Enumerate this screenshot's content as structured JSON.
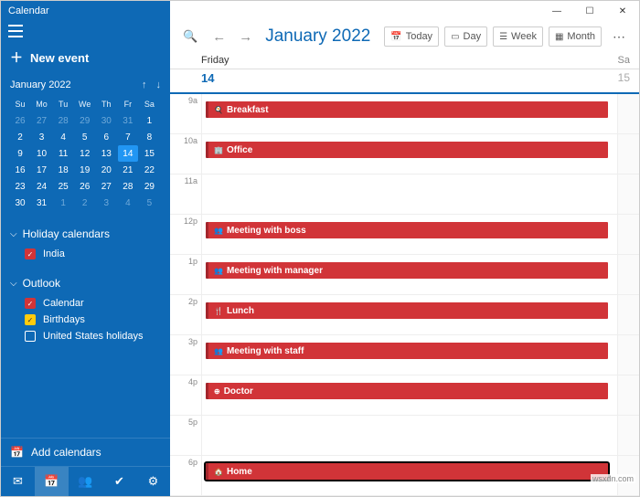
{
  "app_title": "Calendar",
  "sidebar": {
    "new_event": "New event",
    "mini_month": "January 2022",
    "weekdays": [
      "Su",
      "Mo",
      "Tu",
      "We",
      "Th",
      "Fr",
      "Sa"
    ],
    "weeks": [
      [
        {
          "d": "26",
          "dim": true
        },
        {
          "d": "27",
          "dim": true
        },
        {
          "d": "28",
          "dim": true
        },
        {
          "d": "29",
          "dim": true
        },
        {
          "d": "30",
          "dim": true
        },
        {
          "d": "31",
          "dim": true
        },
        {
          "d": "1",
          "dim": false
        }
      ],
      [
        {
          "d": "2"
        },
        {
          "d": "3"
        },
        {
          "d": "4"
        },
        {
          "d": "5"
        },
        {
          "d": "6"
        },
        {
          "d": "7"
        },
        {
          "d": "8"
        }
      ],
      [
        {
          "d": "9"
        },
        {
          "d": "10"
        },
        {
          "d": "11"
        },
        {
          "d": "12"
        },
        {
          "d": "13"
        },
        {
          "d": "14",
          "today": true
        },
        {
          "d": "15"
        }
      ],
      [
        {
          "d": "16"
        },
        {
          "d": "17"
        },
        {
          "d": "18"
        },
        {
          "d": "19"
        },
        {
          "d": "20"
        },
        {
          "d": "21"
        },
        {
          "d": "22"
        }
      ],
      [
        {
          "d": "23"
        },
        {
          "d": "24"
        },
        {
          "d": "25"
        },
        {
          "d": "26"
        },
        {
          "d": "27"
        },
        {
          "d": "28"
        },
        {
          "d": "29"
        }
      ],
      [
        {
          "d": "30"
        },
        {
          "d": "31"
        },
        {
          "d": "1",
          "dim": true
        },
        {
          "d": "2",
          "dim": true
        },
        {
          "d": "3",
          "dim": true
        },
        {
          "d": "4",
          "dim": true
        },
        {
          "d": "5",
          "dim": true
        }
      ]
    ],
    "sections": {
      "holiday": {
        "label": "Holiday calendars",
        "items": [
          {
            "label": "India",
            "color": "red",
            "checked": true
          }
        ]
      },
      "outlook": {
        "label": "Outlook",
        "items": [
          {
            "label": "Calendar",
            "color": "red",
            "checked": true
          },
          {
            "label": "Birthdays",
            "color": "yellow",
            "checked": true
          },
          {
            "label": "United States holidays",
            "color": "",
            "checked": false
          }
        ]
      }
    },
    "add_calendars": "Add calendars"
  },
  "toolbar": {
    "month_title": "January 2022",
    "today": "Today",
    "day": "Day",
    "week": "Week",
    "month": "Month"
  },
  "day_header": {
    "fri": "Friday",
    "sa": "Sa"
  },
  "dates": {
    "d14": "14",
    "d15": "15"
  },
  "hours": [
    "9a",
    "10a",
    "11a",
    "12p",
    "1p",
    "2p",
    "3p",
    "4p",
    "5p",
    "6p"
  ],
  "events": {
    "0": {
      "label": "Breakfast",
      "icon": "🍳"
    },
    "1": {
      "label": "Office",
      "icon": "🏢"
    },
    "3": {
      "label": "Meeting with boss",
      "icon": "👥"
    },
    "4": {
      "label": "Meeting with manager",
      "icon": "👥"
    },
    "5": {
      "label": "Lunch",
      "icon": "🍴"
    },
    "6": {
      "label": "Meeting with staff",
      "icon": "👥"
    },
    "7": {
      "label": "Doctor",
      "icon": "⊕"
    },
    "9": {
      "label": "Home",
      "icon": "🏠",
      "selected": true
    }
  },
  "watermark": "wsxdn.com"
}
